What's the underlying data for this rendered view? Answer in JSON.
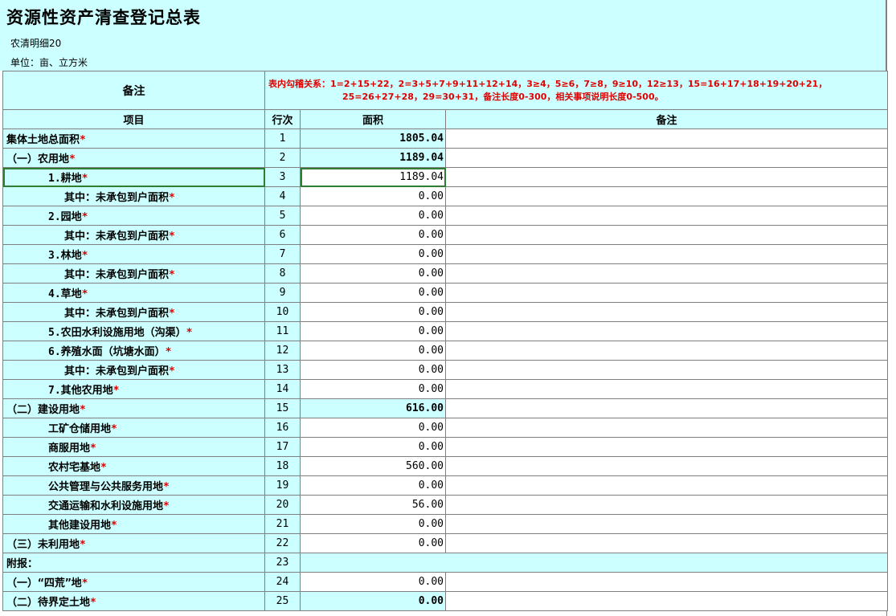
{
  "header": {
    "title": "资源性资产清查登记总表",
    "code": "农清明细20",
    "unit": "单位：亩、立方米"
  },
  "remark": {
    "label": "备注",
    "line1": "表内勾稽关系：1=2+15+22，2=3+5+7+9+11+12+14，3≥4，5≥6，7≥8，9≥10，12≥13，15=16+17+18+19+20+21，",
    "line2": "25=26+27+28，29=30+31，备注长度0-300，相关事项说明长度0-500。"
  },
  "columns": {
    "item": "项目",
    "row": "行次",
    "area": "面积",
    "note": "备注"
  },
  "star": "*",
  "rows": [
    {
      "label": "集体土地总面积",
      "row": "1",
      "area": "1805.04",
      "indent": 0,
      "bold": true,
      "star": true
    },
    {
      "label": "（一）农用地",
      "row": "2",
      "area": "1189.04",
      "indent": 0,
      "bold": true,
      "star": true
    },
    {
      "label": "1.耕地",
      "row": "3",
      "area": "1189.04",
      "indent": 2,
      "star": true,
      "selected": true
    },
    {
      "label": "其中：未承包到户面积",
      "row": "4",
      "area": "0.00",
      "indent": 3,
      "star": true
    },
    {
      "label": "2.园地",
      "row": "5",
      "area": "0.00",
      "indent": 2,
      "star": true
    },
    {
      "label": "其中：未承包到户面积",
      "row": "6",
      "area": "0.00",
      "indent": 3,
      "star": true
    },
    {
      "label": "3.林地",
      "row": "7",
      "area": "0.00",
      "indent": 2,
      "star": true
    },
    {
      "label": "其中：未承包到户面积",
      "row": "8",
      "area": "0.00",
      "indent": 3,
      "star": true
    },
    {
      "label": "4.草地",
      "row": "9",
      "area": "0.00",
      "indent": 2,
      "star": true
    },
    {
      "label": "其中：未承包到户面积",
      "row": "10",
      "area": "0.00",
      "indent": 3,
      "star": true
    },
    {
      "label": "5.农田水利设施用地（沟渠）",
      "row": "11",
      "area": "0.00",
      "indent": 2,
      "star": true
    },
    {
      "label": "6.养殖水面（坑塘水面）",
      "row": "12",
      "area": "0.00",
      "indent": 2,
      "star": true
    },
    {
      "label": "其中：未承包到户面积",
      "row": "13",
      "area": "0.00",
      "indent": 3,
      "star": true
    },
    {
      "label": "7.其他农用地",
      "row": "14",
      "area": "0.00",
      "indent": 2,
      "star": true
    },
    {
      "label": "（二）建设用地",
      "row": "15",
      "area": "616.00",
      "indent": 0,
      "bold": true,
      "star": true
    },
    {
      "label": "工矿仓储用地",
      "row": "16",
      "area": "0.00",
      "indent": 2,
      "star": true
    },
    {
      "label": "商服用地",
      "row": "17",
      "area": "0.00",
      "indent": 2,
      "star": true
    },
    {
      "label": "农村宅基地",
      "row": "18",
      "area": "560.00",
      "indent": 2,
      "star": true
    },
    {
      "label": "公共管理与公共服务用地",
      "row": "19",
      "area": "0.00",
      "indent": 2,
      "star": true
    },
    {
      "label": "交通运输和水利设施用地",
      "row": "20",
      "area": "56.00",
      "indent": 2,
      "star": true
    },
    {
      "label": "其他建设用地",
      "row": "21",
      "area": "0.00",
      "indent": 2,
      "star": true
    },
    {
      "label": "（三）未利用地",
      "row": "22",
      "area": "0.00",
      "indent": 0,
      "star": true
    },
    {
      "label": "附报：",
      "row": "23",
      "area": "",
      "indent": 0,
      "star": false,
      "section": true
    },
    {
      "label": "（一）“四荒”地",
      "row": "24",
      "area": "0.00",
      "indent": 0,
      "star": true
    },
    {
      "label": "（二）待界定土地",
      "row": "25",
      "area": "0.00",
      "indent": 0,
      "bold": true,
      "star": true
    }
  ]
}
